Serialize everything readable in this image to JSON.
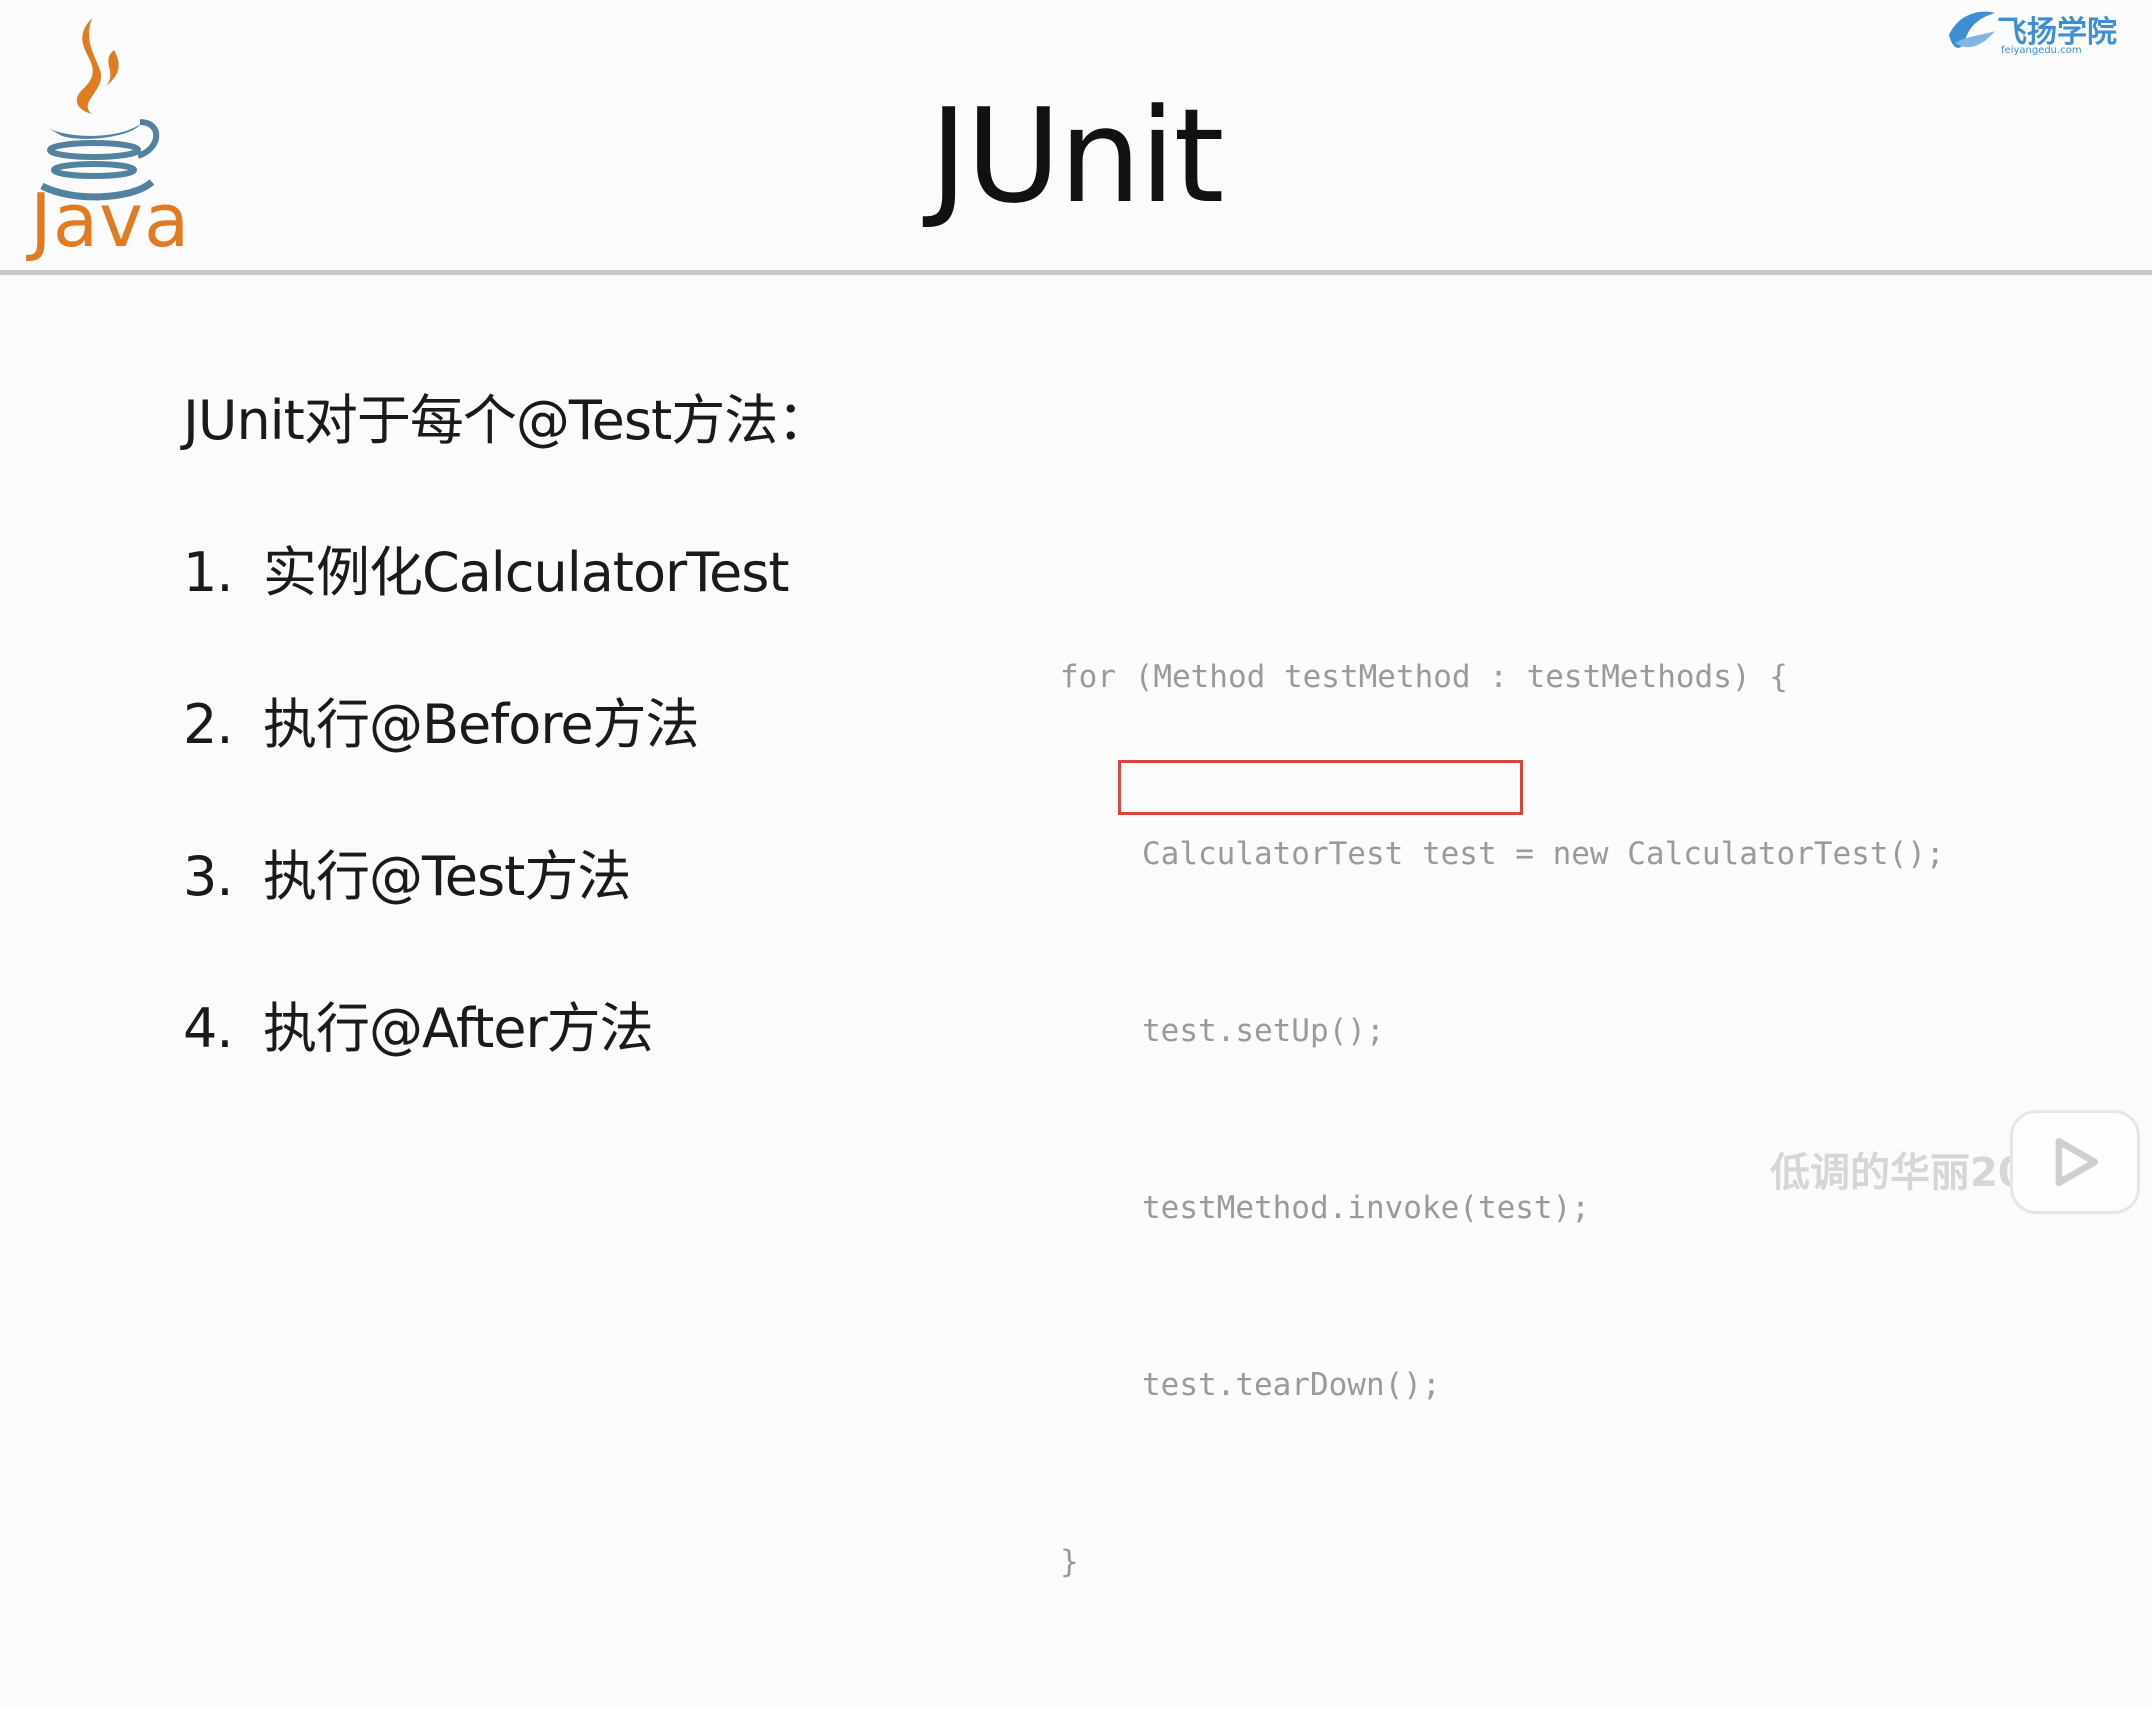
{
  "header": {
    "logo_text": "Java",
    "title": "JUnit",
    "brand_name": "飞扬学院",
    "brand_url": "feiyangedu.com"
  },
  "body": {
    "intro": "JUnit对于每个@Test方法：",
    "steps": [
      {
        "num": "1.",
        "text": "实例化CalculatorTest"
      },
      {
        "num": "2.",
        "text": "执行@Before方法"
      },
      {
        "num": "3.",
        "text": "执行@Test方法"
      },
      {
        "num": "4.",
        "text": "执行@After方法"
      }
    ],
    "code_lines": [
      "for (Method testMethod : testMethods) {",
      "CalculatorTest test = new CalculatorTest();",
      "test.setUp();",
      "testMethod.invoke(test);",
      "test.tearDown();",
      "}"
    ]
  },
  "overlay": {
    "watermark": "低调的华丽2016",
    "play_icon": "play-icon"
  },
  "colors": {
    "java_orange": "#e07b22",
    "java_blue": "#5382a1",
    "highlight_border": "#d9453d",
    "brand_blue": "#3d8fd1"
  }
}
